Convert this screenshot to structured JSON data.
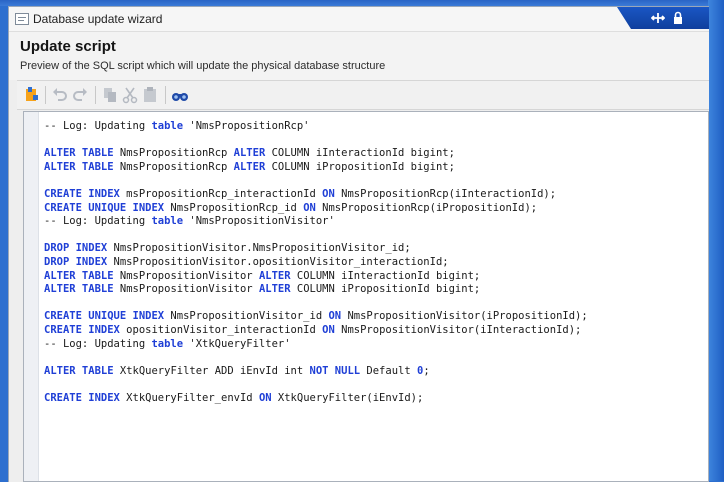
{
  "window": {
    "title": "Database update wizard"
  },
  "header": {
    "title": "Update script",
    "subtitle": "Preview of the SQL script which will update the physical database structure"
  },
  "toolbar": {
    "buttons": [
      "new-document-icon",
      "undo-icon",
      "redo-icon",
      "copy-icon",
      "cut-icon",
      "paste-icon",
      "find-icon"
    ]
  },
  "colors": {
    "keyword": "#1f3fd6",
    "desktop_accent": "#2d6fcf"
  },
  "script": {
    "lines": [
      [
        {
          "t": "-- Log: Updating ",
          "c": "cm"
        },
        {
          "t": "table",
          "c": "kw"
        },
        {
          "t": " 'NmsPropositionRcp'",
          "c": "str"
        }
      ],
      [],
      [
        {
          "t": "ALTER TABLE",
          "c": "kw"
        },
        {
          "t": " NmsPropositionRcp "
        },
        {
          "t": "ALTER",
          "c": "kw"
        },
        {
          "t": " COLUMN iInteractionId bigint;"
        }
      ],
      [
        {
          "t": "ALTER TABLE",
          "c": "kw"
        },
        {
          "t": " NmsPropositionRcp "
        },
        {
          "t": "ALTER",
          "c": "kw"
        },
        {
          "t": " COLUMN iPropositionId bigint;"
        }
      ],
      [],
      [
        {
          "t": "CREATE INDEX",
          "c": "kw"
        },
        {
          "t": " msPropositionRcp_interactionId "
        },
        {
          "t": "ON",
          "c": "kw"
        },
        {
          "t": " NmsPropositionRcp(iInteractionId);"
        }
      ],
      [
        {
          "t": "CREATE UNIQUE INDEX",
          "c": "kw"
        },
        {
          "t": " NmsPropositionRcp_id "
        },
        {
          "t": "ON",
          "c": "kw"
        },
        {
          "t": " NmsPropositionRcp(iPropositionId);"
        }
      ],
      [
        {
          "t": "-- Log: Updating ",
          "c": "cm"
        },
        {
          "t": "table",
          "c": "kw"
        },
        {
          "t": " 'NmsPropositionVisitor'",
          "c": "str"
        }
      ],
      [],
      [
        {
          "t": "DROP INDEX",
          "c": "kw"
        },
        {
          "t": " NmsPropositionVisitor.NmsPropositionVisitor_id;"
        }
      ],
      [
        {
          "t": "DROP INDEX",
          "c": "kw"
        },
        {
          "t": " NmsPropositionVisitor.opositionVisitor_interactionId;"
        }
      ],
      [
        {
          "t": "ALTER TABLE",
          "c": "kw"
        },
        {
          "t": " NmsPropositionVisitor "
        },
        {
          "t": "ALTER",
          "c": "kw"
        },
        {
          "t": " COLUMN iInteractionId bigint;"
        }
      ],
      [
        {
          "t": "ALTER TABLE",
          "c": "kw"
        },
        {
          "t": " NmsPropositionVisitor "
        },
        {
          "t": "ALTER",
          "c": "kw"
        },
        {
          "t": " COLUMN iPropositionId bigint;"
        }
      ],
      [],
      [
        {
          "t": "CREATE UNIQUE INDEX",
          "c": "kw"
        },
        {
          "t": " NmsPropositionVisitor_id "
        },
        {
          "t": "ON",
          "c": "kw"
        },
        {
          "t": " NmsPropositionVisitor(iPropositionId);"
        }
      ],
      [
        {
          "t": "CREATE INDEX",
          "c": "kw"
        },
        {
          "t": " opositionVisitor_interactionId "
        },
        {
          "t": "ON",
          "c": "kw"
        },
        {
          "t": " NmsPropositionVisitor(iInteractionId);"
        }
      ],
      [
        {
          "t": "-- Log: Updating ",
          "c": "cm"
        },
        {
          "t": "table",
          "c": "kw"
        },
        {
          "t": " 'XtkQueryFilter'",
          "c": "str"
        }
      ],
      [],
      [
        {
          "t": "ALTER TABLE",
          "c": "kw"
        },
        {
          "t": " XtkQueryFilter ADD iEnvId int "
        },
        {
          "t": "NOT NULL",
          "c": "kw"
        },
        {
          "t": " Default "
        },
        {
          "t": "0",
          "c": "num"
        },
        {
          "t": ";"
        }
      ],
      [],
      [
        {
          "t": "CREATE INDEX",
          "c": "kw"
        },
        {
          "t": " XtkQueryFilter_envId "
        },
        {
          "t": "ON",
          "c": "kw"
        },
        {
          "t": " XtkQueryFilter(iEnvId);"
        }
      ]
    ]
  }
}
